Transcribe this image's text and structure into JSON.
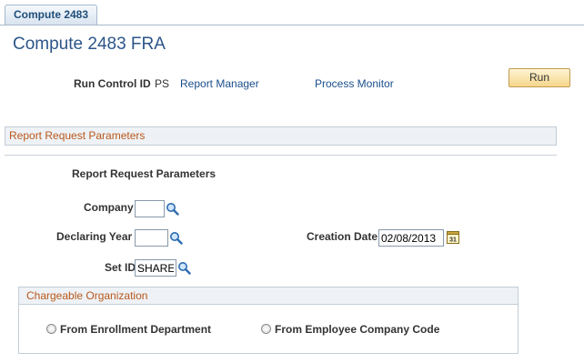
{
  "tabs": [
    {
      "label": "Compute 2483"
    }
  ],
  "page_title": "Compute 2483 FRA",
  "run_control": {
    "label": "Run Control ID",
    "value": "PS",
    "report_manager_link": "Report Manager",
    "process_monitor_link": "Process Monitor",
    "run_button": "Run"
  },
  "section": {
    "title": "Report Request Parameters",
    "subtitle": "Report Request Parameters"
  },
  "fields": {
    "company": {
      "label": "Company",
      "value": ""
    },
    "declaring_year": {
      "label": "Declaring Year",
      "value": ""
    },
    "creation_date": {
      "label": "Creation Date",
      "value": "02/08/2013"
    },
    "set_id": {
      "label": "Set ID",
      "value": "SHARE"
    }
  },
  "chargeable_org": {
    "title": "Chargeable Organization",
    "options": [
      {
        "label": "From Enrollment Department",
        "selected": false
      },
      {
        "label": "From Employee Company Code",
        "selected": false
      }
    ]
  },
  "icons": {
    "lookup": "magnifier-icon",
    "calendar": "calendar-icon"
  },
  "colors": {
    "title": "#2c5589",
    "section_text": "#b8571a",
    "link": "#1a4e8c",
    "run_button": "#f5d58a"
  }
}
